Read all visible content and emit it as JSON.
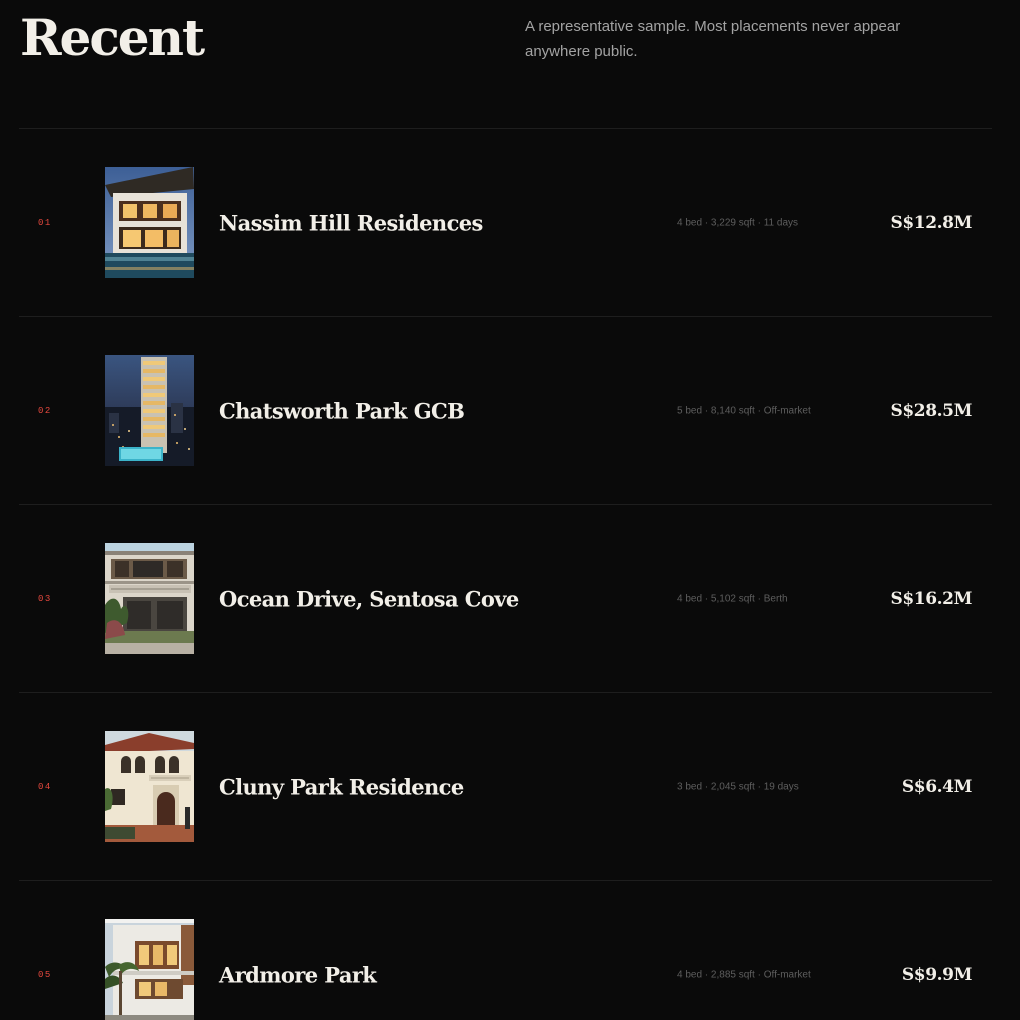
{
  "header": {
    "title": "Recent",
    "intro": "A representative sample. Most placements never appear anywhere public."
  },
  "listings": [
    {
      "index": "01",
      "name": "Nassim Hill Residences",
      "meta": "4 bed · 3,229 sqft · 11 days",
      "price": "S$12.8M",
      "photo": "modern-villa-pool-dusk-photo"
    },
    {
      "index": "02",
      "name": "Chatsworth Park GCB",
      "meta": "5 bed · 8,140 sqft · Off-market",
      "price": "S$28.5M",
      "photo": "tower-night-city-photo"
    },
    {
      "index": "03",
      "name": "Ocean Drive, Sentosa Cove",
      "meta": "4 bed · 5,102 sqft · Berth",
      "price": "S$16.2M",
      "photo": "modern-house-balcony-photo"
    },
    {
      "index": "04",
      "name": "Cluny Park Residence",
      "meta": "3 bed · 2,045 sqft · 19 days",
      "price": "S$6.4M",
      "photo": "classical-villa-photo"
    },
    {
      "index": "05",
      "name": "Ardmore Park",
      "meta": "4 bed · 2,885 sqft · Off-market",
      "price": "S$9.9M",
      "photo": "white-house-palm-photo"
    }
  ],
  "colors": {
    "background": "#0a0a0a",
    "index_accent": "#e5483e",
    "divider": "#1e1e1e",
    "text": "#f2efe8",
    "muted": "#5e5e5e"
  }
}
